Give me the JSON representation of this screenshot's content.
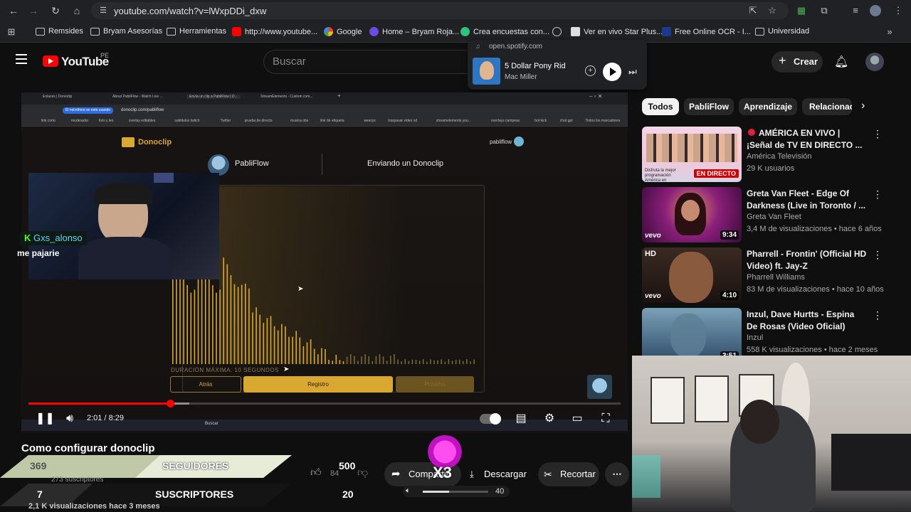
{
  "browser": {
    "url": "youtube.com/watch?v=lWxpDDi_dxw",
    "bookmarks": [
      {
        "label": "Remsides",
        "kind": "folder"
      },
      {
        "label": "Bryam Asesorías",
        "kind": "folder"
      },
      {
        "label": "Herramientas",
        "kind": "folder"
      },
      {
        "label": "http://www.youtube...",
        "kind": "youtube"
      },
      {
        "label": "Google",
        "kind": "google"
      },
      {
        "label": "Home – Bryam Roja...",
        "kind": "site"
      },
      {
        "label": "Crea encuestas con...",
        "kind": "site"
      },
      {
        "label": "",
        "kind": "globe"
      },
      {
        "label": "Ver en vivo Star Plus...",
        "kind": "site"
      },
      {
        "label": "Free Online OCR - I...",
        "kind": "site"
      },
      {
        "label": "Universidad",
        "kind": "folder"
      }
    ]
  },
  "spotify": {
    "source": "open.spotify.com",
    "track": "5 Dollar Pony Ride",
    "artist": "Mac Miller"
  },
  "header": {
    "logo_text": "YouTube",
    "region": "PE",
    "search_placeholder": "Buscar",
    "create_label": "Crear"
  },
  "video": {
    "inner_tabs": [
      "Enlaces | Donoclip",
      "About PabliFlow - Watch Live ...",
      "Envía un clip a PabliFlow | D...",
      "StreamElements - Custom com..."
    ],
    "inner_mic_notice": "El micrófono se está usando",
    "inner_url": "donoclip.com/pabliflow",
    "inner_bookmarks": [
      "link corto",
      "moderador",
      "foto u leo",
      "overlay editables",
      "subtitulos twitch",
      "Twitter",
      "prueba de directo",
      "musica obs",
      "link de etiqueta",
      "weezyx",
      "traspasar video xd",
      "streamelements you...",
      "overlays campeas",
      "bot kick",
      "chat gpt",
      "Todos los marcadores"
    ],
    "donoclip_brand": "Donoclip",
    "donoclip_user": "pabliflow",
    "streamer_name": "PabliFlow",
    "sending_label": "Enviando un Donoclip",
    "duration_label": "DURACIÓN MÁXIMA: 10 SEGUNDOS",
    "back_btn": "Atrás",
    "record_btn": "Registro",
    "next_btn": "Próximo",
    "chat_user": "Gxs_alonso",
    "chat_message": "me pajarie",
    "taskbar_search": "Buscar",
    "time_current": "2:01",
    "time_total": "8:29",
    "time_display": "2:01 / 8:29",
    "progress_fraction": 0.239,
    "buffer_fraction": 0.272,
    "volume_value": "40"
  },
  "below": {
    "title": "Como configurar donoclip",
    "subs_text": "273 suscriptores",
    "views_text": "2,1 K visualizaciones  hace 3 meses",
    "likes": "84",
    "share_label": "Compartir",
    "download_label": "Descargar",
    "clip_label": "Recortar",
    "overlay": {
      "followers_count": "369",
      "followers_label": "SEGUIDORES",
      "followers_goal": "500",
      "subs_count": "7",
      "subs_label": "SUSCRIPTORES",
      "subs_goal": "20",
      "multiplier": "X3"
    }
  },
  "sidebar": {
    "chips": [
      "Todos",
      "PabliFlow",
      "Aprendizaje",
      "Relacionado"
    ],
    "recs": [
      {
        "title": "AMÉRICA EN VIVO | ¡Señal de TV EN DIRECTO ...",
        "channel": "América Televisión",
        "meta": "29 K usuarios",
        "badge": "EN DIRECTO",
        "thumb_caption": "Disfruta la mejor programación América en"
      },
      {
        "title": "Greta Van Fleet - Edge Of Darkness (Live in Toronto / ...",
        "channel": "Greta Van Fleet",
        "meta": "3,4 M de visualizaciones • hace 6 años",
        "duration": "9:34",
        "label": "vevo"
      },
      {
        "title": "Pharrell - Frontin' (Official HD Video) ft. Jay-Z",
        "channel": "Pharrell Williams",
        "meta": "83 M de visualizaciones • hace 10 años",
        "duration": "4:10",
        "label": "vevo",
        "hd": "HD"
      },
      {
        "title": "Inzul, Dave Hurtts - Espina De Rosas (Video Oficial)",
        "channel": "Inzul",
        "meta": "558 K visualizaciones • hace 2 meses",
        "duration": "3:51"
      }
    ]
  },
  "colors": {
    "accent_red": "#ff0000",
    "gold": "#d9a830",
    "spotify_green": "#1ed760"
  }
}
